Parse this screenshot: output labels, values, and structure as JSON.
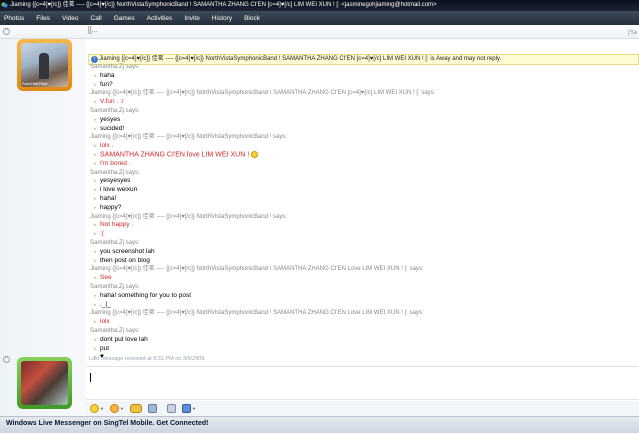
{
  "window": {
    "title": "Jiaming {[c=4]♥[/c]} 佳茗 ---- {[c=4]♥[/c]} NorthVistaSymphonicBand ! SAMANTHA ZHANG CI'EN [c=4]♥[/c] LIM WEI XUN ! [: <jasminegohjiaming@hotmail.com>"
  },
  "menu": [
    "Photos",
    "Files",
    "Video",
    "Call",
    "Games",
    "Activities",
    "Invite",
    "History",
    "Block"
  ],
  "contact_strip": {
    "name_truncated": "[[...",
    "name_right": "[Sa"
  },
  "avatar_caption": "Sam'Hatt'Rnbr",
  "away_notice": "Jiaming {[c=4]♥[/c]} 佳茗 ---- {[c=4]♥[/c]} NorthVistaSymphonicBand ! SAMANTHA ZHANG CI'EN [c=4]♥[/c] LIM WEI XUN ! [: is Away and may not reply.",
  "messages": [
    {
      "type": "header",
      "text": "Samantha.Zj says:"
    },
    {
      "type": "line",
      "text": "haha"
    },
    {
      "type": "line",
      "text": "fun?"
    },
    {
      "type": "header",
      "text": "Jiaming {[c=4]♥[/c]} 佳茗 ---- {[c=4]♥[/c]} NorthVistaSymphonicBand ! SAMANTHA ZHANG CI'EN [c=4]♥[/c] LIM WEI XUN ! [: says:"
    },
    {
      "type": "line",
      "text": "V.fun . :/",
      "color": "red"
    },
    {
      "type": "header",
      "text": "Samantha.Zj says:"
    },
    {
      "type": "line",
      "text": "yesyes"
    },
    {
      "type": "line",
      "text": "sucided!"
    },
    {
      "type": "header",
      "text": "Jiaming {[c=4]♥[/c]} 佳茗 ---- {[c=4]♥[/c]} NorthVistaSymphonicBand ! says:"
    },
    {
      "type": "line",
      "text": "lolx .",
      "color": "red"
    },
    {
      "type": "line",
      "text": "SAMANTHA ZHANG CI'EN love LIM WEI XUN !",
      "color": "red",
      "big": true,
      "smiley": true
    },
    {
      "type": "line",
      "text": "I'm bored .",
      "color": "red"
    },
    {
      "type": "header",
      "text": "Samantha.Zj says:"
    },
    {
      "type": "line",
      "text": "yesyesyes"
    },
    {
      "type": "line",
      "text": "i love weixun"
    },
    {
      "type": "line",
      "text": "haha!"
    },
    {
      "type": "line",
      "text": "happy?"
    },
    {
      "type": "header",
      "text": "Jiaming {[c=4]♥[/c]} 佳茗 ---- {[c=4]♥[/c]} NorthVistaSymphonicBand ! says:"
    },
    {
      "type": "line",
      "text": "Not happy .",
      "color": "red"
    },
    {
      "type": "line",
      "text": ":(",
      "color": "red"
    },
    {
      "type": "header",
      "text": "Samantha.Zj says:"
    },
    {
      "type": "line",
      "text": "you screenshot lah"
    },
    {
      "type": "line",
      "text": "then post on blog"
    },
    {
      "type": "header",
      "text": "Jiaming {[c=4]♥[/c]} 佳茗 ---- {[c=4]♥[/c]} NorthVistaSymphonicBand ! SAMANTHA ZHANG CI'EN Love LIM WEI XUN ! [: says:"
    },
    {
      "type": "line",
      "text": "See",
      "color": "red"
    },
    {
      "type": "header",
      "text": "Samantha.Zj says:"
    },
    {
      "type": "line",
      "text": "haha! something for you to post"
    },
    {
      "type": "line",
      "text": "._|_"
    },
    {
      "type": "header",
      "text": "Jiaming {[c=4]♥[/c]} 佳茗 ---- {[c=4]♥[/c]} NorthVistaSymphonicBand ! SAMANTHA ZHANG CI'EN Love LIM WEI XUN ! [: says:"
    },
    {
      "type": "line",
      "text": "lolx",
      "color": "red"
    },
    {
      "type": "header",
      "text": "Samantha.Zj says:"
    },
    {
      "type": "line",
      "text": "dont put love lah"
    },
    {
      "type": "line",
      "text": "put"
    },
    {
      "type": "line",
      "text": "♥"
    },
    {
      "type": "line",
      "text": "haha"
    }
  ],
  "last_received": "Last message received at 8:31 PM on 3/5/2009.",
  "toolbar": {
    "emoticon_icon": "emoticon-icon",
    "wink_icon": "wink-icon",
    "nudge_icon": "nudge-icon",
    "voice_clip_icon": "voice-clip-icon",
    "font_icon": "font-icon",
    "background_icon": "background-icon"
  },
  "footer_text": "Windows Live Messenger on SingTel Mobile. Get Connected!"
}
